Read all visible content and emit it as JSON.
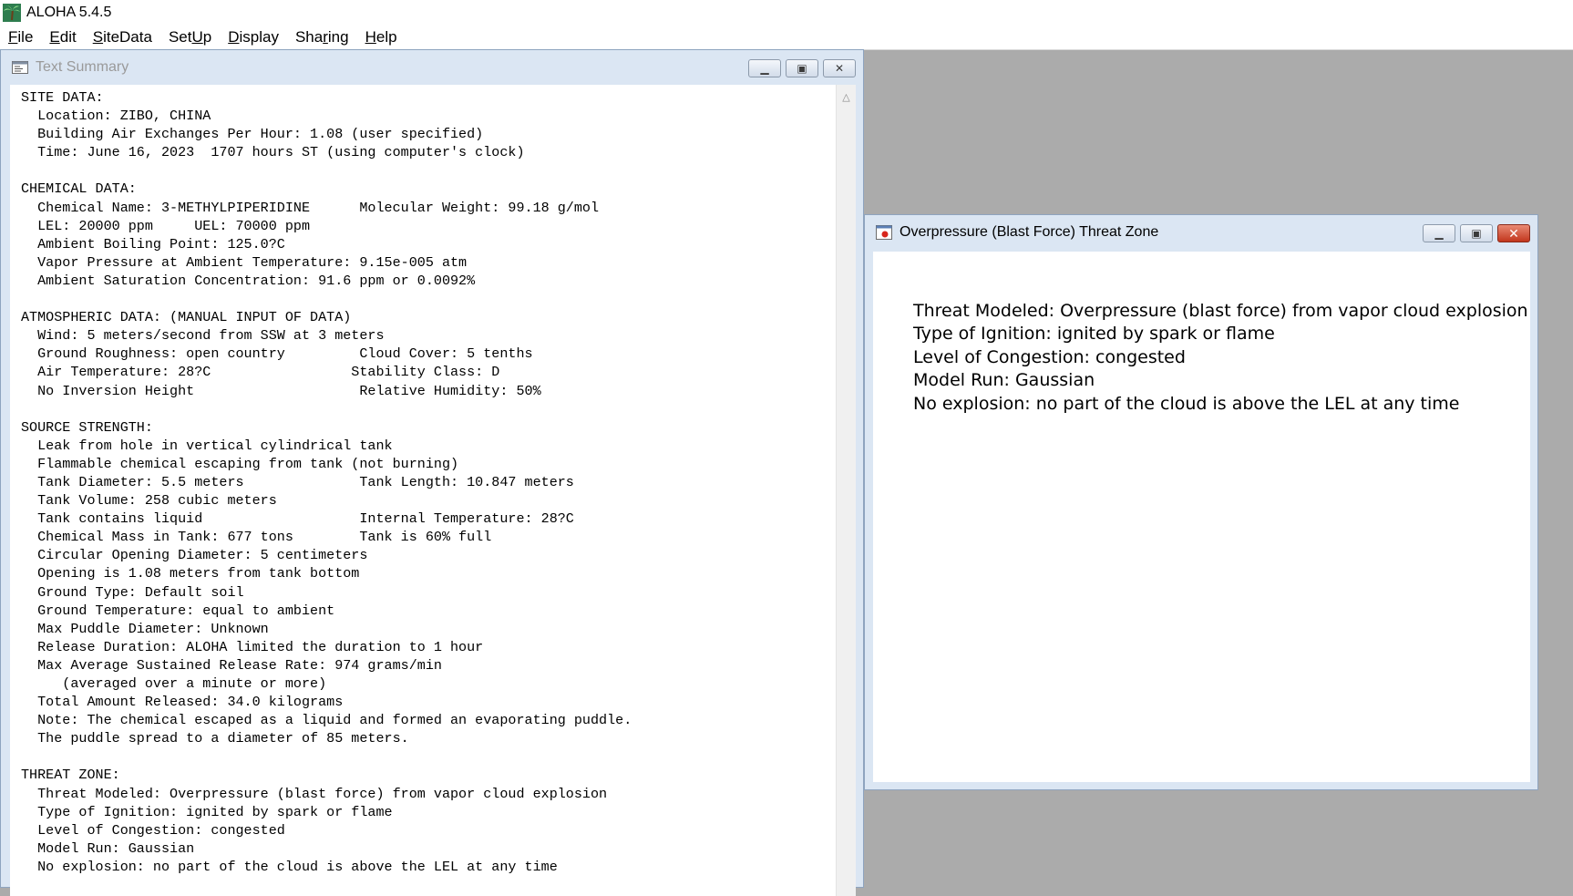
{
  "app": {
    "title": "ALOHA 5.4.5",
    "icon": "palm-tree-icon"
  },
  "menu": [
    {
      "label": "File",
      "mnemonic": "F"
    },
    {
      "label": "Edit",
      "mnemonic": "E"
    },
    {
      "label": "SiteData",
      "mnemonic": "S"
    },
    {
      "label": "SetUp",
      "mnemonic": "U"
    },
    {
      "label": "Display",
      "mnemonic": "D"
    },
    {
      "label": "Sharing",
      "mnemonic": "r"
    },
    {
      "label": "Help",
      "mnemonic": "H"
    }
  ],
  "text_summary": {
    "title": "Text Summary",
    "icon": "text-document-icon",
    "lines": [
      "SITE DATA:",
      "  Location: ZIBO, CHINA",
      "  Building Air Exchanges Per Hour: 1.08 (user specified)",
      "  Time: June 16, 2023  1707 hours ST (using computer's clock)",
      "",
      "CHEMICAL DATA:",
      "  Chemical Name: 3-METHYLPIPERIDINE      Molecular Weight: 99.18 g/mol",
      "  LEL: 20000 ppm     UEL: 70000 ppm",
      "  Ambient Boiling Point: 125.0?C",
      "  Vapor Pressure at Ambient Temperature: 9.15e-005 atm",
      "  Ambient Saturation Concentration: 91.6 ppm or 0.0092%",
      "",
      "ATMOSPHERIC DATA: (MANUAL INPUT OF DATA)",
      "  Wind: 5 meters/second from SSW at 3 meters",
      "  Ground Roughness: open country         Cloud Cover: 5 tenths",
      "  Air Temperature: 28?C                 Stability Class: D",
      "  No Inversion Height                    Relative Humidity: 50%",
      "",
      "SOURCE STRENGTH:",
      "  Leak from hole in vertical cylindrical tank",
      "  Flammable chemical escaping from tank (not burning)",
      "  Tank Diameter: 5.5 meters              Tank Length: 10.847 meters",
      "  Tank Volume: 258 cubic meters",
      "  Tank contains liquid                   Internal Temperature: 28?C",
      "  Chemical Mass in Tank: 677 tons        Tank is 60% full",
      "  Circular Opening Diameter: 5 centimeters",
      "  Opening is 1.08 meters from tank bottom",
      "  Ground Type: Default soil",
      "  Ground Temperature: equal to ambient",
      "  Max Puddle Diameter: Unknown",
      "  Release Duration: ALOHA limited the duration to 1 hour",
      "  Max Average Sustained Release Rate: 974 grams/min",
      "     (averaged over a minute or more)",
      "  Total Amount Released: 34.0 kilograms",
      "  Note: The chemical escaped as a liquid and formed an evaporating puddle.",
      "  The puddle spread to a diameter of 85 meters.",
      "",
      "THREAT ZONE:",
      "  Threat Modeled: Overpressure (blast force) from vapor cloud explosion",
      "  Type of Ignition: ignited by spark or flame",
      "  Level of Congestion: congested",
      "  Model Run: Gaussian",
      "  No explosion: no part of the cloud is above the LEL at any time"
    ]
  },
  "threat_zone_window": {
    "title": "Overpressure (Blast Force) Threat Zone",
    "icon": "threat-zone-icon",
    "lines": [
      "Threat Modeled: Overpressure (blast force) from vapor cloud explosion",
      "Type of Ignition: ignited by spark or flame",
      "Level of Congestion: congested",
      "Model Run: Gaussian",
      "No explosion: no part of the cloud is above the LEL at any time"
    ]
  },
  "window_controls": {
    "minimize": "minimize-icon",
    "restore": "restore-icon",
    "close": "close-icon"
  },
  "colors": {
    "desktop": "#ababab",
    "mdi_frame": "#dbe6f3",
    "close_active": "#c2361d"
  }
}
